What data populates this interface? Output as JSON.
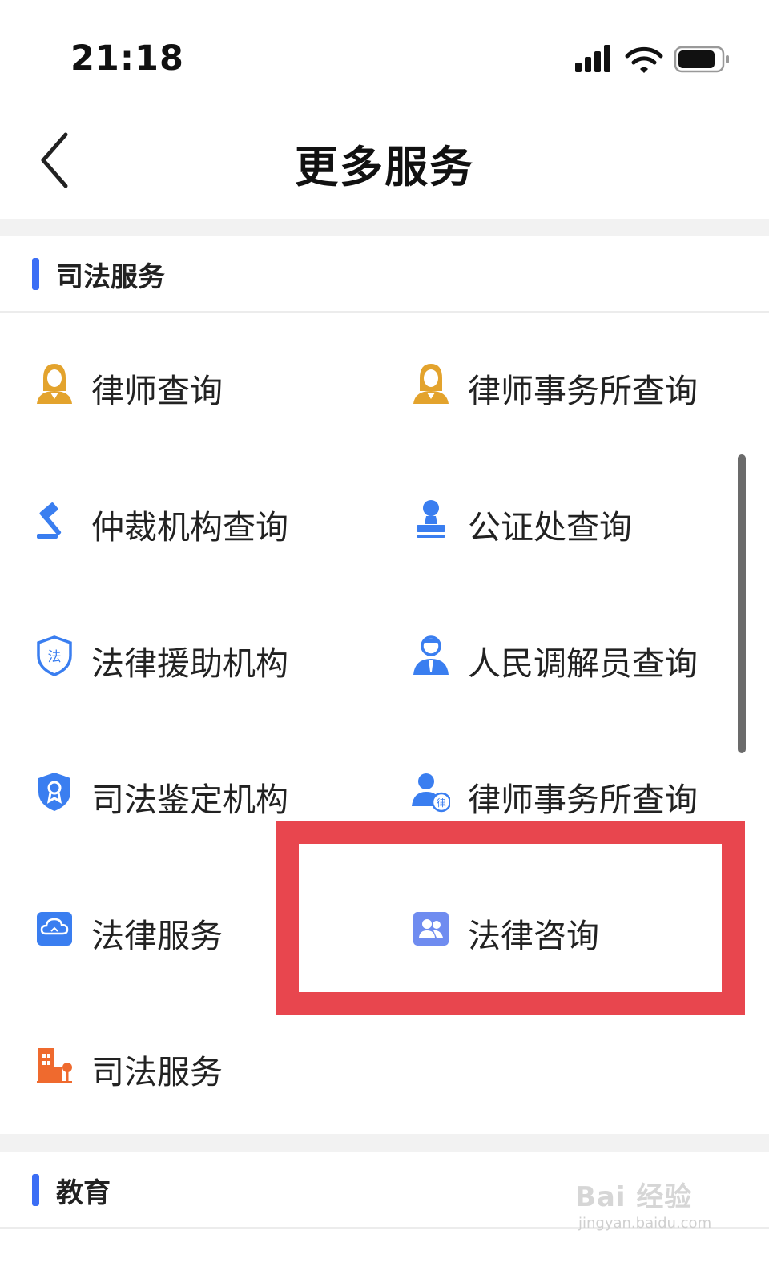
{
  "status": {
    "time": "21:18"
  },
  "nav": {
    "title": "更多服务"
  },
  "sections": [
    {
      "title": "司法服务",
      "items": [
        {
          "label": "律师查询",
          "icon": "lawyer-icon"
        },
        {
          "label": "律师事务所查询",
          "icon": "lawyer-icon"
        },
        {
          "label": "仲裁机构查询",
          "icon": "gavel-icon"
        },
        {
          "label": "公证处查询",
          "icon": "notary-icon"
        },
        {
          "label": "法律援助机构",
          "icon": "shield-law-icon"
        },
        {
          "label": "人民调解员查询",
          "icon": "mediator-icon"
        },
        {
          "label": "司法鉴定机构",
          "icon": "appraisal-shield-icon"
        },
        {
          "label": "律师事务所查询",
          "icon": "lawyer-badge-icon"
        },
        {
          "label": "法律服务",
          "icon": "cloud-service-icon"
        },
        {
          "label": "法律咨询",
          "icon": "consult-people-icon"
        },
        {
          "label": "司法服务",
          "icon": "building-icon"
        }
      ]
    },
    {
      "title": "教育",
      "items": []
    }
  ],
  "watermark": {
    "main": "Bai 经验",
    "sub": "jingyan.baidu.com"
  },
  "colors": {
    "accent": "#3b6ef5",
    "highlight": "#e8464e",
    "gold": "#e3a32d",
    "blue": "#3a7ef0",
    "orange": "#ef6a2e"
  }
}
